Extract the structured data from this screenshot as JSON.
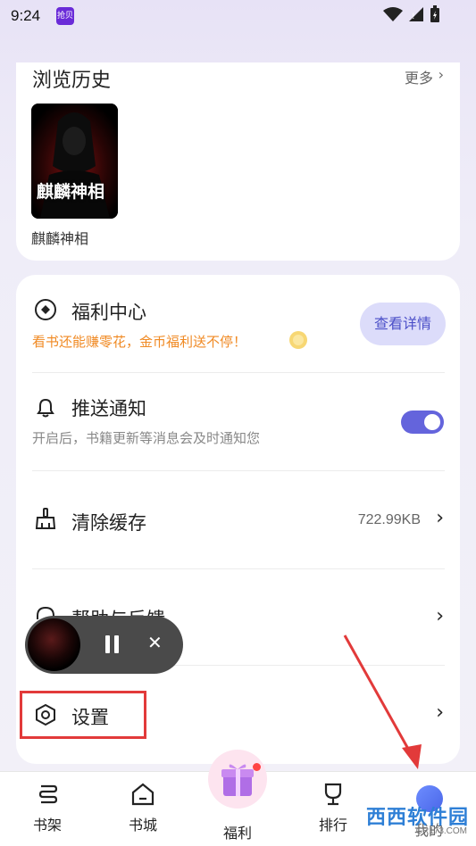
{
  "status": {
    "time": "9:24",
    "app_icon_text": "抢贝"
  },
  "history": {
    "title": "浏览历史",
    "more": "更多",
    "book": {
      "cover_text": "麒麟神相",
      "title": "麒麟神相"
    }
  },
  "welfare": {
    "title": "福利中心",
    "subtitle": "看书还能赚零花，金币福利送不停！",
    "button": "查看详情"
  },
  "push": {
    "title": "推送通知",
    "subtitle": "开启后，书籍更新等消息会及时通知您",
    "enabled": true
  },
  "cache": {
    "title": "清除缓存",
    "size": "722.99KB"
  },
  "help": {
    "title": "帮助与反馈"
  },
  "settings": {
    "title": "设置"
  },
  "player": {
    "close": "✕"
  },
  "tabs": [
    {
      "label": "书架"
    },
    {
      "label": "书城"
    },
    {
      "label": "福利"
    },
    {
      "label": "排行"
    },
    {
      "label": "我的"
    }
  ],
  "watermark": {
    "text": "西西软件园",
    "sub": "CR173.COM"
  },
  "colors": {
    "accent": "#6464dc",
    "orange": "#f08a24",
    "highlight": "#e23a3a"
  }
}
